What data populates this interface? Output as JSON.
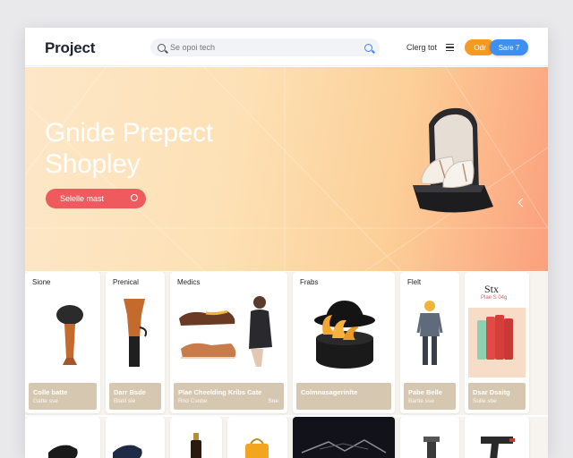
{
  "header": {
    "logo": "Project",
    "search_placeholder": "Se opoi tech",
    "nav_link": "Clerg tot",
    "btn_orange": "Odr",
    "btn_blue": "Sare 7"
  },
  "hero": {
    "title_line1": "Gnide Prepect",
    "title_line2": "Shopley",
    "cta": "Selelle mast"
  },
  "cards": [
    {
      "category": "Sione",
      "name": "Colle batte",
      "price": "Gatte sse"
    },
    {
      "category": "Prenical",
      "name": "Darr Bsde",
      "price": "Blatil sle"
    },
    {
      "category": "Medics",
      "name": "Plae Cheelding Kribs Cate",
      "price": "Rnd Csobe",
      "extra": "Sne"
    },
    {
      "category": "Frabs",
      "name": "Colmnasagerinfte",
      "price": ""
    },
    {
      "category": "Flelt",
      "name": "Pabe Belle",
      "price": "Bartie sse"
    },
    {
      "category": "Stx",
      "badge": "Plae S 04g",
      "name": "Dsar Dsaitg",
      "price": "Sulle sbe"
    }
  ],
  "colors": {
    "cta": "#ef5a5f",
    "orange": "#f59a23",
    "blue": "#3d8ff0",
    "card_footer": "#d6c8b0"
  },
  "icons": [
    "search-icon",
    "menu-icon",
    "chevron-right-icon",
    "arrow-circle-icon"
  ]
}
